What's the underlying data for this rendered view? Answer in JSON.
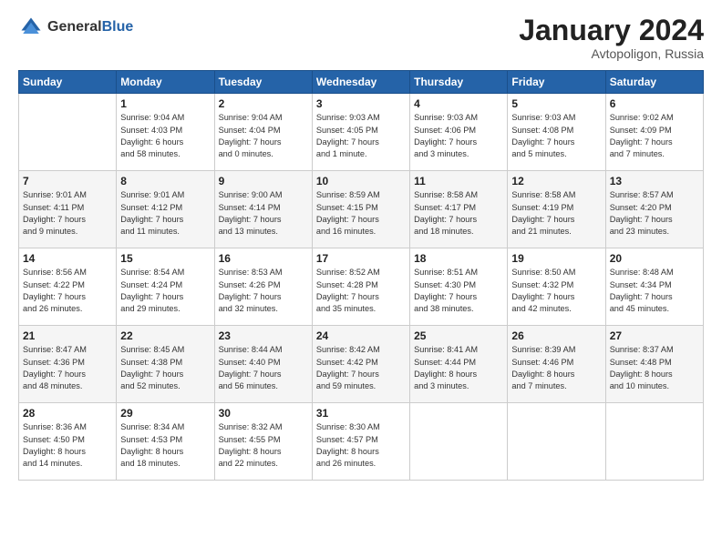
{
  "header": {
    "logo_general": "General",
    "logo_blue": "Blue",
    "month": "January 2024",
    "location": "Avtopoligon, Russia"
  },
  "days_of_week": [
    "Sunday",
    "Monday",
    "Tuesday",
    "Wednesday",
    "Thursday",
    "Friday",
    "Saturday"
  ],
  "weeks": [
    [
      {
        "day": "",
        "info": ""
      },
      {
        "day": "1",
        "info": "Sunrise: 9:04 AM\nSunset: 4:03 PM\nDaylight: 6 hours\nand 58 minutes."
      },
      {
        "day": "2",
        "info": "Sunrise: 9:04 AM\nSunset: 4:04 PM\nDaylight: 7 hours\nand 0 minutes."
      },
      {
        "day": "3",
        "info": "Sunrise: 9:03 AM\nSunset: 4:05 PM\nDaylight: 7 hours\nand 1 minute."
      },
      {
        "day": "4",
        "info": "Sunrise: 9:03 AM\nSunset: 4:06 PM\nDaylight: 7 hours\nand 3 minutes."
      },
      {
        "day": "5",
        "info": "Sunrise: 9:03 AM\nSunset: 4:08 PM\nDaylight: 7 hours\nand 5 minutes."
      },
      {
        "day": "6",
        "info": "Sunrise: 9:02 AM\nSunset: 4:09 PM\nDaylight: 7 hours\nand 7 minutes."
      }
    ],
    [
      {
        "day": "7",
        "info": "Sunrise: 9:01 AM\nSunset: 4:11 PM\nDaylight: 7 hours\nand 9 minutes."
      },
      {
        "day": "8",
        "info": "Sunrise: 9:01 AM\nSunset: 4:12 PM\nDaylight: 7 hours\nand 11 minutes."
      },
      {
        "day": "9",
        "info": "Sunrise: 9:00 AM\nSunset: 4:14 PM\nDaylight: 7 hours\nand 13 minutes."
      },
      {
        "day": "10",
        "info": "Sunrise: 8:59 AM\nSunset: 4:15 PM\nDaylight: 7 hours\nand 16 minutes."
      },
      {
        "day": "11",
        "info": "Sunrise: 8:58 AM\nSunset: 4:17 PM\nDaylight: 7 hours\nand 18 minutes."
      },
      {
        "day": "12",
        "info": "Sunrise: 8:58 AM\nSunset: 4:19 PM\nDaylight: 7 hours\nand 21 minutes."
      },
      {
        "day": "13",
        "info": "Sunrise: 8:57 AM\nSunset: 4:20 PM\nDaylight: 7 hours\nand 23 minutes."
      }
    ],
    [
      {
        "day": "14",
        "info": "Sunrise: 8:56 AM\nSunset: 4:22 PM\nDaylight: 7 hours\nand 26 minutes."
      },
      {
        "day": "15",
        "info": "Sunrise: 8:54 AM\nSunset: 4:24 PM\nDaylight: 7 hours\nand 29 minutes."
      },
      {
        "day": "16",
        "info": "Sunrise: 8:53 AM\nSunset: 4:26 PM\nDaylight: 7 hours\nand 32 minutes."
      },
      {
        "day": "17",
        "info": "Sunrise: 8:52 AM\nSunset: 4:28 PM\nDaylight: 7 hours\nand 35 minutes."
      },
      {
        "day": "18",
        "info": "Sunrise: 8:51 AM\nSunset: 4:30 PM\nDaylight: 7 hours\nand 38 minutes."
      },
      {
        "day": "19",
        "info": "Sunrise: 8:50 AM\nSunset: 4:32 PM\nDaylight: 7 hours\nand 42 minutes."
      },
      {
        "day": "20",
        "info": "Sunrise: 8:48 AM\nSunset: 4:34 PM\nDaylight: 7 hours\nand 45 minutes."
      }
    ],
    [
      {
        "day": "21",
        "info": "Sunrise: 8:47 AM\nSunset: 4:36 PM\nDaylight: 7 hours\nand 48 minutes."
      },
      {
        "day": "22",
        "info": "Sunrise: 8:45 AM\nSunset: 4:38 PM\nDaylight: 7 hours\nand 52 minutes."
      },
      {
        "day": "23",
        "info": "Sunrise: 8:44 AM\nSunset: 4:40 PM\nDaylight: 7 hours\nand 56 minutes."
      },
      {
        "day": "24",
        "info": "Sunrise: 8:42 AM\nSunset: 4:42 PM\nDaylight: 7 hours\nand 59 minutes."
      },
      {
        "day": "25",
        "info": "Sunrise: 8:41 AM\nSunset: 4:44 PM\nDaylight: 8 hours\nand 3 minutes."
      },
      {
        "day": "26",
        "info": "Sunrise: 8:39 AM\nSunset: 4:46 PM\nDaylight: 8 hours\nand 7 minutes."
      },
      {
        "day": "27",
        "info": "Sunrise: 8:37 AM\nSunset: 4:48 PM\nDaylight: 8 hours\nand 10 minutes."
      }
    ],
    [
      {
        "day": "28",
        "info": "Sunrise: 8:36 AM\nSunset: 4:50 PM\nDaylight: 8 hours\nand 14 minutes."
      },
      {
        "day": "29",
        "info": "Sunrise: 8:34 AM\nSunset: 4:53 PM\nDaylight: 8 hours\nand 18 minutes."
      },
      {
        "day": "30",
        "info": "Sunrise: 8:32 AM\nSunset: 4:55 PM\nDaylight: 8 hours\nand 22 minutes."
      },
      {
        "day": "31",
        "info": "Sunrise: 8:30 AM\nSunset: 4:57 PM\nDaylight: 8 hours\nand 26 minutes."
      },
      {
        "day": "",
        "info": ""
      },
      {
        "day": "",
        "info": ""
      },
      {
        "day": "",
        "info": ""
      }
    ]
  ]
}
